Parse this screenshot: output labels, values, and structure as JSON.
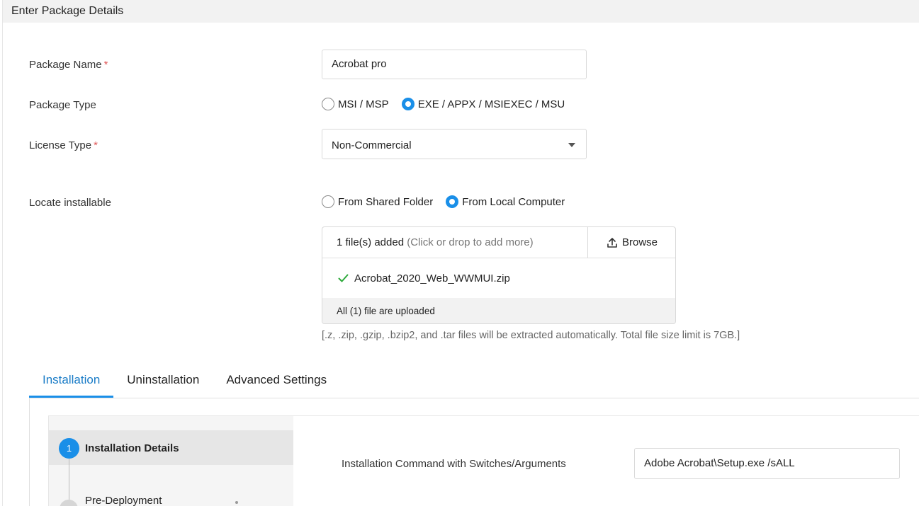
{
  "header": {
    "title": "Enter Package Details"
  },
  "form": {
    "package_name": {
      "label": "Package Name",
      "required_mark": "*",
      "value": "Acrobat pro"
    },
    "package_type": {
      "label": "Package Type",
      "options": [
        {
          "label": "MSI / MSP",
          "selected": false
        },
        {
          "label": "EXE / APPX / MSIEXEC / MSU",
          "selected": true
        }
      ]
    },
    "license_type": {
      "label": "License Type",
      "required_mark": "*",
      "value": "Non-Commercial"
    },
    "locate_installable": {
      "label": "Locate installable",
      "options": [
        {
          "label": "From Shared Folder",
          "selected": false
        },
        {
          "label": "From Local Computer",
          "selected": true
        }
      ]
    },
    "upload": {
      "files_added": "1 file(s) added",
      "drop_hint": "(Click or drop to add more)",
      "browse_label": "Browse",
      "file_name": "Acrobat_2020_Web_WWMUI.zip",
      "status": "All (1) file are uploaded",
      "hint": "[.z, .zip, .gzip, .bzip2, and .tar files will be extracted automatically. Total file size limit is 7GB.]"
    }
  },
  "tabs": [
    {
      "label": "Installation",
      "active": true
    },
    {
      "label": "Uninstallation",
      "active": false
    },
    {
      "label": "Advanced Settings",
      "active": false
    }
  ],
  "installation": {
    "steps": [
      {
        "number": "1",
        "label": "Installation Details",
        "active": true
      },
      {
        "label": "Pre-Deployment",
        "active": false
      }
    ],
    "command_label": "Installation Command with Switches/Arguments",
    "command_value": "Adobe Acrobat\\Setup.exe /sALL"
  },
  "colors": {
    "accent": "#1a8fe8",
    "required": "#e05a5a",
    "success": "#2eaa3c"
  },
  "icons": {
    "browse": "upload-icon",
    "file": "check-icon",
    "select": "caret-down-icon"
  }
}
